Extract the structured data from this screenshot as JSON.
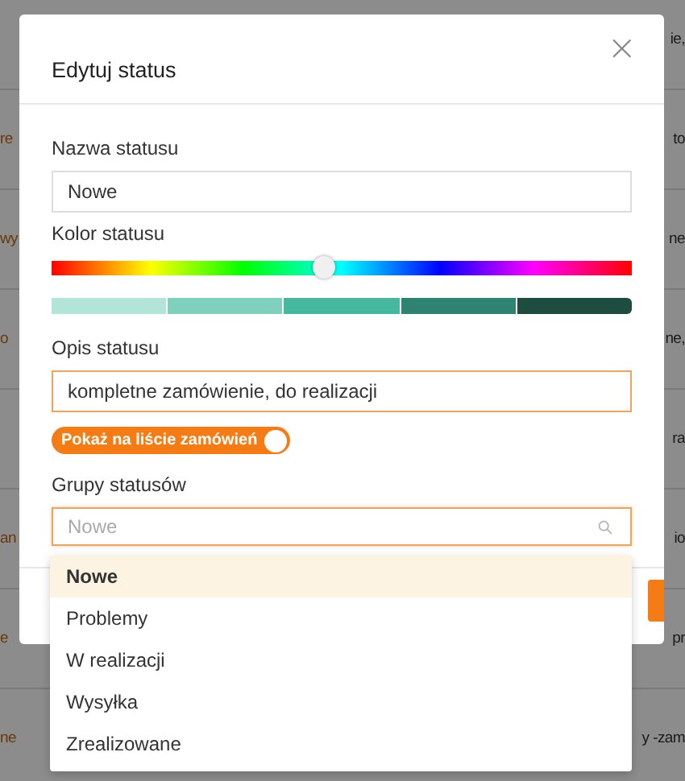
{
  "background_rows": [
    {
      "right": "ie,"
    },
    {
      "left": "re",
      "right": "to"
    },
    {
      "left": "wy",
      "right": "ne"
    },
    {
      "left": "o",
      "right": "ne,"
    },
    {
      "right": "ra"
    },
    {
      "left": "an",
      "right": "io"
    },
    {
      "left": "e",
      "right": "pr"
    },
    {
      "left": "ne",
      "right": "y -zam"
    }
  ],
  "dialog": {
    "title": "Edytuj status",
    "close": "×",
    "name_label": "Nazwa statusu",
    "name_value": "Nowe",
    "color_label": "Kolor statusu",
    "hue_slider": {
      "level": 0.47
    },
    "swatches": [
      {
        "color": "#b3e4d8"
      },
      {
        "color": "#7fd1be"
      },
      {
        "color": "#45b89e"
      },
      {
        "color": "#2e8471"
      },
      {
        "color": "#1e4d40"
      }
    ],
    "description_label": "Opis statusu",
    "description_value": "kompletne zamówienie, do realizacji",
    "toggle": {
      "label": "Pokaż na liście zamówień",
      "on": true
    },
    "groups_label": "Grupy statusów",
    "groups_placeholder": "Nowe",
    "groups_options": [
      {
        "label": "Nowe",
        "selected": true
      },
      {
        "label": "Problemy",
        "selected": false
      },
      {
        "label": "W realizacji",
        "selected": false
      },
      {
        "label": "Wysyłka",
        "selected": false
      },
      {
        "label": "Zrealizowane",
        "selected": false
      }
    ]
  }
}
